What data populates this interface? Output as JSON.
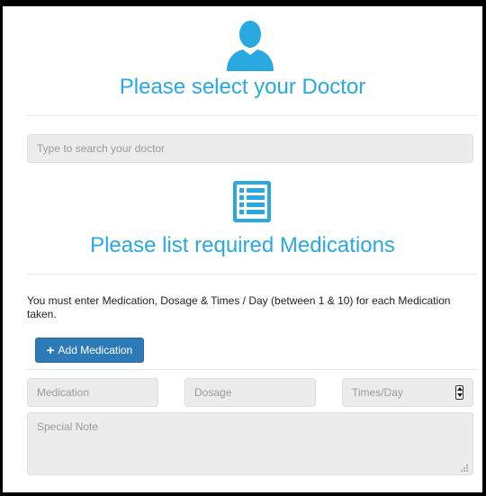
{
  "doctor": {
    "title": "Please select your Doctor",
    "icon": "user-icon",
    "search_placeholder": "Type to search your doctor"
  },
  "medications": {
    "title": "Please list required Medications",
    "icon": "list-icon",
    "instructions": "You must enter Medication, Dosage & Times / Day (between 1 & 10) for each Medication taken.",
    "add_button_label": "Add Medication",
    "fields": {
      "medication_placeholder": "Medication",
      "dosage_placeholder": "Dosage",
      "times_placeholder": "Times/Day",
      "note_placeholder": "Special Note"
    }
  },
  "colors": {
    "accent": "#29a9df",
    "button": "#2d7ab8",
    "field_bg": "#ececec"
  }
}
